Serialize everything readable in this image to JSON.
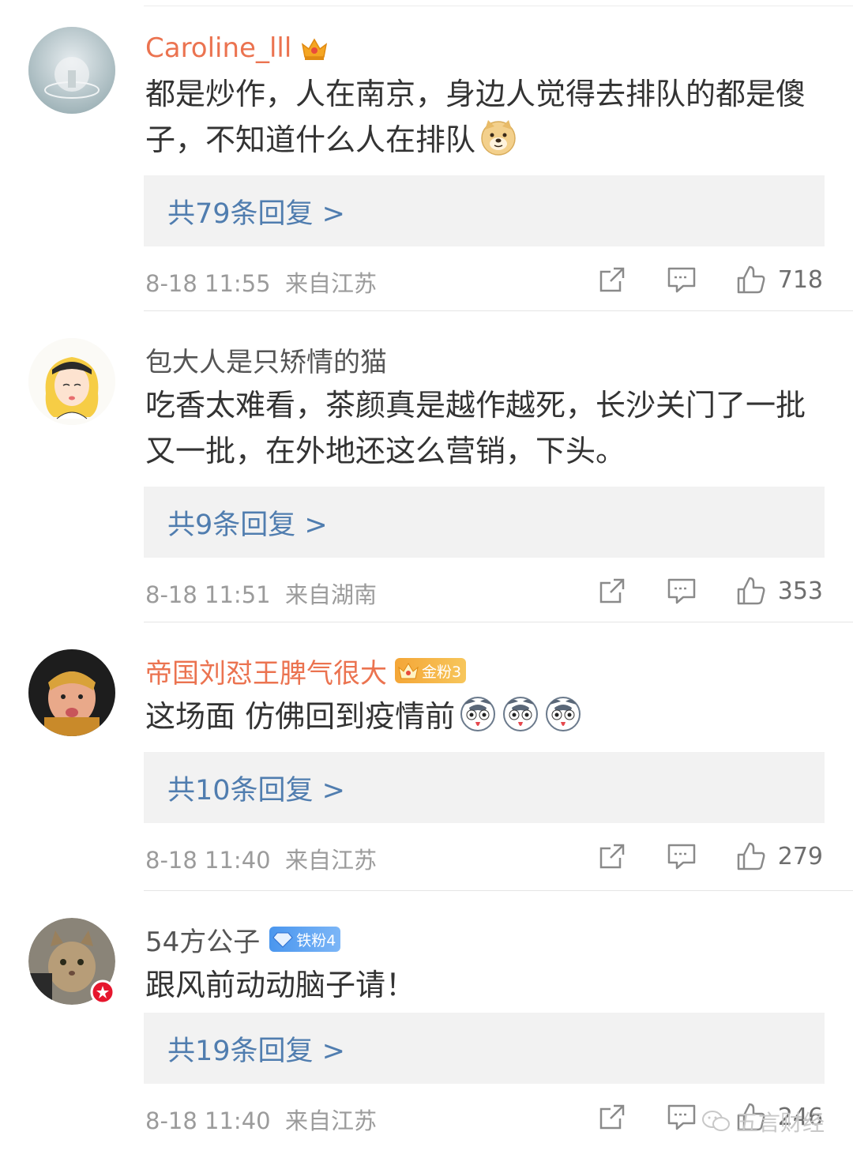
{
  "comments": [
    {
      "username": "Caroline_lll",
      "text": "都是炒作，人在南京，身边人觉得去排队的都是傻子，不知道什么人在排队",
      "replies": "共79条回复 >",
      "time": "8-18 11:55",
      "location": "来自江苏",
      "likes": "718",
      "emoji": "doge-emoji"
    },
    {
      "username": "包大人是只矫情的猫",
      "text": "吃香太难看，茶颜真是越作越死，长沙关门了一批又一批，在外地还这么营销，下头。",
      "replies": "共9条回复 >",
      "time": "8-18 11:51",
      "location": "来自湖南",
      "likes": "353"
    },
    {
      "username": "帝国刘怼王脾气很大",
      "badge": "金粉3",
      "text": "这场面 仿佛回到疫情前",
      "replies": "共10条回复 >",
      "time": "8-18 11:40",
      "location": "来自江苏",
      "likes": "279",
      "emoji": "husky-emoji"
    },
    {
      "username": "54方公子",
      "badge": "铁粉4",
      "text": "跟风前动动脑子请！",
      "replies": "共19条回复 >",
      "time": "8-18 11:40",
      "location": "来自江苏",
      "likes": "246"
    }
  ],
  "watermark": "五言财经",
  "colors": {
    "vip_name": "#eb7350",
    "link": "#507daf",
    "meta": "#9b9b9b",
    "reply_bg": "#f2f2f2"
  }
}
